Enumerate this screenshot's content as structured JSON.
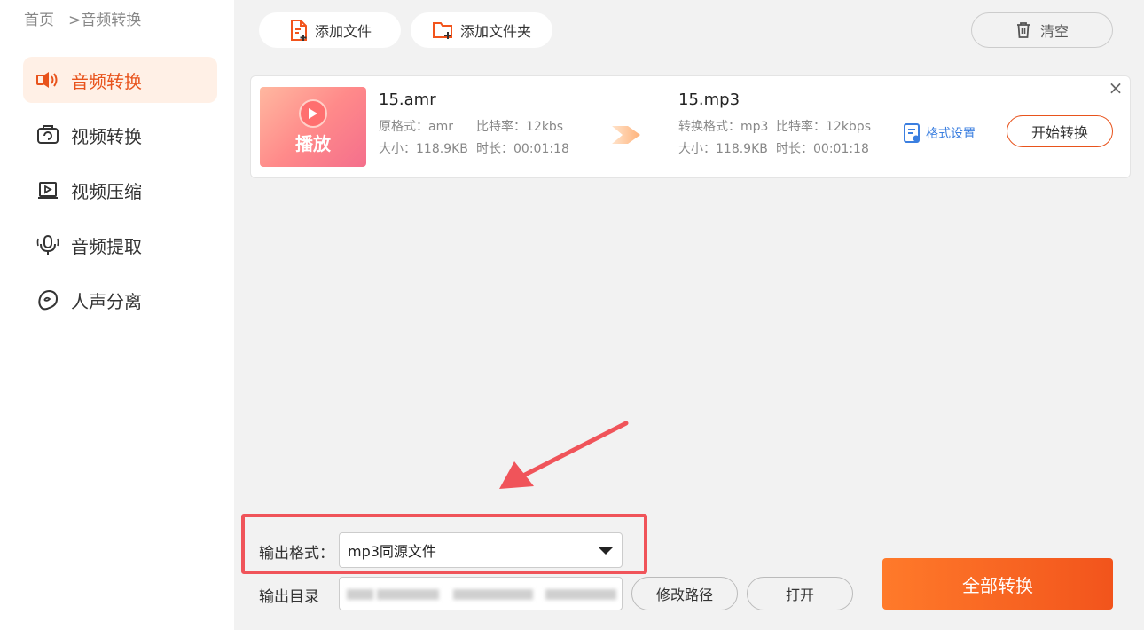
{
  "breadcrumb": {
    "home": "首页",
    "current": ">音频转换"
  },
  "sidebar": {
    "items": [
      {
        "label": "音频转换",
        "icon": "speaker-icon",
        "active": true
      },
      {
        "label": "视频转换",
        "icon": "camera-icon",
        "active": false
      },
      {
        "label": "视频压缩",
        "icon": "video-compress-icon",
        "active": false
      },
      {
        "label": "音频提取",
        "icon": "microphone-icon",
        "active": false
      },
      {
        "label": "人声分离",
        "icon": "voice-separate-icon",
        "active": false
      }
    ]
  },
  "toolbar": {
    "add_file": "添加文件",
    "add_folder": "添加文件夹",
    "clear": "清空"
  },
  "file": {
    "thumb_label": "播放",
    "source": {
      "name": "15.amr",
      "format": "原格式：amr",
      "bitrate": "比特率：12kbs",
      "size": "大小：118.9KB",
      "duration": "时长：00:01:18"
    },
    "target": {
      "name": "15.mp3",
      "format": "转换格式：mp3",
      "bitrate": "比特率：12kbps",
      "size": "大小：118.9KB",
      "duration": "时长：00:01:18"
    },
    "format_settings": "格式设置",
    "start_button": "开始转换"
  },
  "output": {
    "format_label": "输出格式：",
    "format_value": "mp3同源文件",
    "dir_label": "输出目录",
    "change_path": "修改路径",
    "open": "打开",
    "convert_all": "全部转换"
  },
  "colors": {
    "accent": "#e8531c",
    "highlight": "#f0545a",
    "link": "#3b7fe0"
  }
}
